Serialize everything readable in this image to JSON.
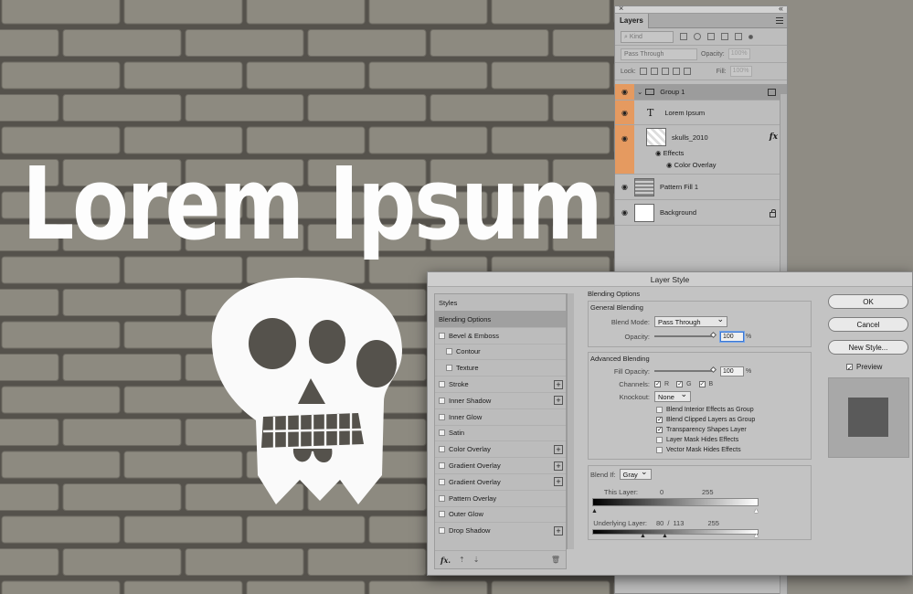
{
  "canvas": {
    "title_text": "Lorem Ipsum"
  },
  "layers_panel": {
    "close_glyph": "×",
    "collapse_glyph": "«",
    "tab_label": "Layers",
    "filter_kind": "Kind",
    "blend_mode": "Pass Through",
    "opacity_label": "Opacity:",
    "opacity_value": "100%",
    "lock_label": "Lock:",
    "fill_label": "Fill:",
    "fill_value": "100%",
    "group_arrow": "⌄",
    "text_layer_glyph": "T",
    "layers": [
      {
        "name": "Group 1"
      },
      {
        "name": "Lorem Ipsum"
      },
      {
        "name": "skulls_2010",
        "fx": "fx"
      },
      {
        "name": "Effects"
      },
      {
        "name": "Color Overlay"
      },
      {
        "name": "Pattern Fill 1"
      },
      {
        "name": "Background"
      }
    ]
  },
  "dialog": {
    "title": "Layer Style",
    "styles_header": "Styles",
    "style_items": [
      {
        "label": "Blending Options"
      },
      {
        "label": "Bevel & Emboss"
      },
      {
        "label": "Contour"
      },
      {
        "label": "Texture"
      },
      {
        "label": "Stroke"
      },
      {
        "label": "Inner Shadow"
      },
      {
        "label": "Inner Glow"
      },
      {
        "label": "Satin"
      },
      {
        "label": "Color Overlay"
      },
      {
        "label": "Gradient Overlay"
      },
      {
        "label": "Gradient Overlay"
      },
      {
        "label": "Pattern Overlay"
      },
      {
        "label": "Outer Glow"
      },
      {
        "label": "Drop Shadow"
      }
    ],
    "footer": {
      "fx": "fx.",
      "up": "⇡",
      "down": "⇣",
      "trash": "🗑"
    },
    "blending_options": "Blending Options",
    "general_blending": "General Blending",
    "blend_mode_label": "Blend Mode:",
    "blend_mode_value": "Pass Through",
    "opacity_label": "Opacity:",
    "opacity_value": "100",
    "advanced_blending": "Advanced Blending",
    "fill_opacity_label": "Fill Opacity:",
    "fill_opacity_value": "100",
    "percent": "%",
    "channels_label": "Channels:",
    "channel_r": "R",
    "channel_g": "G",
    "channel_b": "B",
    "knockout_label": "Knockout:",
    "knockout_value": "None",
    "adv_checks": [
      {
        "label": "Blend Interior Effects as Group"
      },
      {
        "label": "Blend Clipped Layers as Group"
      },
      {
        "label": "Transparency Shapes Layer"
      },
      {
        "label": "Layer Mask Hides Effects"
      },
      {
        "label": "Vector Mask Hides Effects"
      }
    ],
    "blend_if_label": "Blend If:",
    "blend_if_value": "Gray",
    "this_layer_label": "This Layer:",
    "this_layer_low": "0",
    "this_layer_high": "255",
    "underlying_label": "Underlying Layer:",
    "underlying_low": "80",
    "underlying_sep": "/",
    "underlying_mid": "113",
    "underlying_high": "255",
    "ok": "OK",
    "cancel": "Cancel",
    "new_style": "New Style...",
    "preview_label": "Preview"
  }
}
